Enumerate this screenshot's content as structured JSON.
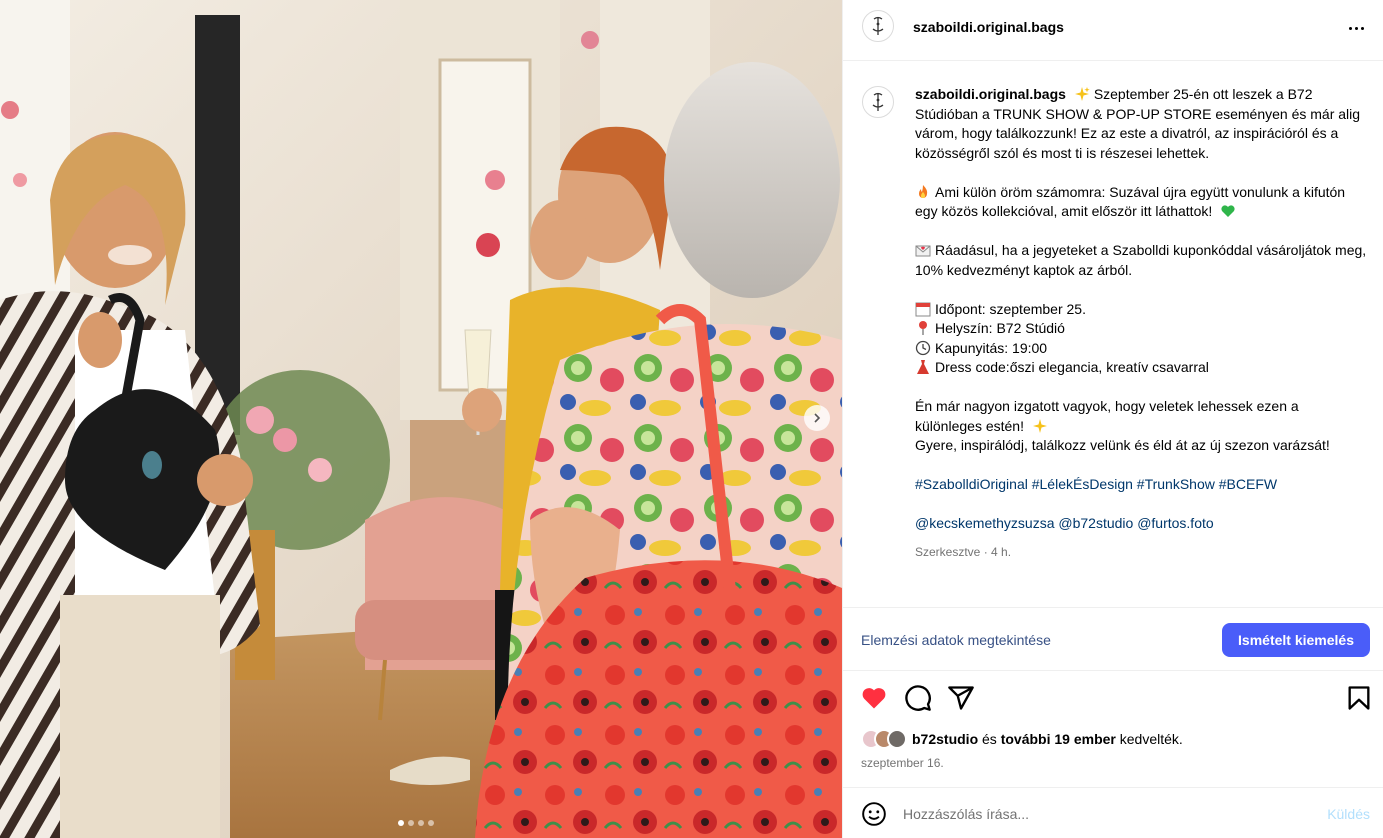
{
  "post": {
    "username": "szaboildi.original.bags",
    "more_icon": "more-horizontal-icon",
    "caption": {
      "username": "szaboildi.original.bags",
      "para1": "Szeptember 25-én ott leszek a B72 Stúdióban a TRUNK SHOW & POP-UP STORE eseményen és már alig várom, hogy találkozzunk! Ez az este a divatról, az inspirációról és a közösségről szól és most ti is részesei lehettek.",
      "para2": "Ami külön öröm számomra: Suzával újra együtt vonulunk a kifutón egy közös kollekcióval, amit először itt láthattok!",
      "para3": "Ráadásul, ha a jegyeteket a Szabolldi kuponkóddal vásároljátok meg, 10% kedvezményt kaptok az árból.",
      "event_date": "Időpont: szeptember 25.",
      "event_place": "Helyszín: B72 Stúdió",
      "event_doors": "Kapunyitás: 19:00",
      "event_dress": "Dress code:őszi elegancia, kreatív csavarral",
      "para5a": "Én már nagyon izgatott vagyok, hogy veletek lehessek ezen a különleges estén!",
      "para5b": "Gyere, inspirálódj, találkozz velünk és éld át az új szezon varázsát!",
      "hashtags": "#SzabolldiOriginal #LélekÉsDesign #TrunkShow #BCEFW",
      "mentions": "@kecskemethyzsuzsa @b72studio @furtos.foto",
      "meta": "Szerkesztve · 4 h."
    },
    "insights_label": "Elemzési adatok megtekintése",
    "boost_label": "Ismételt kiemelés",
    "likes": {
      "user": "b72studio",
      "connector": "és",
      "others": "további 19 ember",
      "suffix": "kedvelték."
    },
    "date": "szeptember 16.",
    "comment_placeholder": "Hozzászólás írása...",
    "send_label": "Küldés",
    "carousel": {
      "slide_count": 4,
      "active_index": 0
    },
    "colors": {
      "like_red": "#ff3040",
      "link": "#00376b",
      "boost_blue": "#4a5df9"
    }
  }
}
